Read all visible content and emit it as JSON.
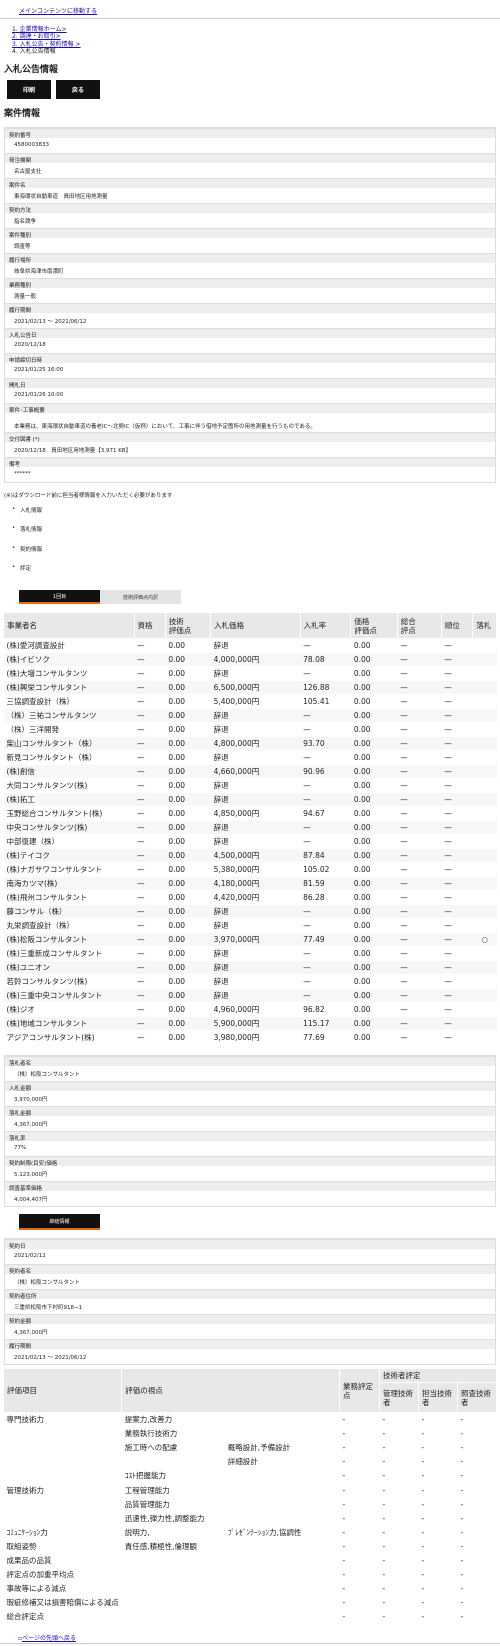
{
  "skip_link": "メインコンテンツに移動する",
  "breadcrumb": [
    "1. 企業情報ホーム>",
    "2. 調達・お取引>",
    "3. 入札公告・契約情報 >",
    "4. 入札公告情報"
  ],
  "page_title": "入札公告情報",
  "buttons": {
    "print": "印刷",
    "back": "戻る"
  },
  "section_title": "案件情報",
  "info": [
    {
      "label": "契約番号",
      "value": "4580003833"
    },
    {
      "label": "発注機関",
      "value": "名古屋支社"
    },
    {
      "label": "案件名",
      "value": "東海環状自動車道　員田地区用地測量"
    },
    {
      "label": "契約方法",
      "value": "指名競争"
    },
    {
      "label": "案件種別",
      "value": "調査等"
    },
    {
      "label": "履行場所",
      "value": "岐阜県海津市南濃町"
    },
    {
      "label": "業務種別",
      "value": "測量一般"
    },
    {
      "label": "履行期間",
      "value": "2021/02/13 ～ 2021/06/12"
    },
    {
      "label": "入札公告日",
      "value": "2020/12/18"
    },
    {
      "label": "申請締切日時",
      "value": "2021/01/25 16:00"
    },
    {
      "label": "開札日",
      "value": "2021/01/26 10:00"
    },
    {
      "label": "案件･工事概要",
      "value": "本業務は、東海環状自動車道の養老IC～北勢IC（仮称）において、工事に伴う借地予定箇所の用地測量を行うものである。"
    },
    {
      "label": "交付図書 (*)",
      "value": "2020/12/18　員田地区用地測量【3,971 KB】"
    },
    {
      "label": "備考",
      "value": "******"
    }
  ],
  "download_note": "(※)はダウンロード前に担当者様情報を入力いただく必要があります",
  "links": [
    "入札情報",
    "落札情報",
    "契約情報",
    "評定"
  ],
  "tabs": {
    "round1": "1回目",
    "tech": "技術評価点内訳"
  },
  "bid_headers": [
    "事業者名",
    "資格",
    "技術\n評価点",
    "入札価格",
    "入札率",
    "価格\n評価点",
    "総合\n評点",
    "順位",
    "落札"
  ],
  "bids": [
    [
      "(株)愛河調査設計",
      "—",
      "0.00",
      "辞退",
      "—",
      "0.00",
      "—",
      "—",
      ""
    ],
    [
      "(株)イビソク",
      "—",
      "0.00",
      "4,000,000円",
      "78.08",
      "0.00",
      "—",
      "—",
      ""
    ],
    [
      "(株)大増コンサルタンツ",
      "—",
      "0.00",
      "辞退",
      "—",
      "0.00",
      "—",
      "—",
      ""
    ],
    [
      "(株)興栄コンサルタント",
      "—",
      "0.00",
      "6,500,000円",
      "126.88",
      "0.00",
      "—",
      "—",
      ""
    ],
    [
      "三協調査設計（株）",
      "—",
      "0.00",
      "5,400,000円",
      "105.41",
      "0.00",
      "—",
      "—",
      ""
    ],
    [
      "（株）三祐コンサルタンツ",
      "—",
      "0.00",
      "辞退",
      "—",
      "0.00",
      "—",
      "—",
      ""
    ],
    [
      "（株）三洋開発",
      "—",
      "0.00",
      "辞退",
      "—",
      "0.00",
      "—",
      "—",
      ""
    ],
    [
      "柴山コンサルタント（株）",
      "—",
      "0.00",
      "4,800,000円",
      "93.70",
      "0.00",
      "—",
      "—",
      ""
    ],
    [
      "新見コンサルタント（株）",
      "—",
      "0.00",
      "辞退",
      "—",
      "0.00",
      "—",
      "—",
      ""
    ],
    [
      "(株)創信",
      "—",
      "0.00",
      "4,660,000円",
      "90.96",
      "0.00",
      "—",
      "—",
      ""
    ],
    [
      "大同コンサルタンツ(株)",
      "—",
      "0.00",
      "辞退",
      "—",
      "0.00",
      "—",
      "—",
      ""
    ],
    [
      "(株)拓工",
      "—",
      "0.00",
      "辞退",
      "—",
      "0.00",
      "—",
      "—",
      ""
    ],
    [
      "玉野総合コンサルタント(株)",
      "—",
      "0.00",
      "4,850,000円",
      "94.67",
      "0.00",
      "—",
      "—",
      ""
    ],
    [
      "中央コンサルタンツ(株)",
      "—",
      "0.00",
      "辞退",
      "—",
      "0.00",
      "—",
      "—",
      ""
    ],
    [
      "中部復建（株）",
      "—",
      "0.00",
      "辞退",
      "—",
      "0.00",
      "—",
      "—",
      ""
    ],
    [
      "(株)テイコク",
      "—",
      "0.00",
      "4,500,000円",
      "87.84",
      "0.00",
      "—",
      "—",
      ""
    ],
    [
      "(株)ナガサワコンサルタント",
      "—",
      "0.00",
      "5,380,000円",
      "105.02",
      "0.00",
      "—",
      "—",
      ""
    ],
    [
      "南海カツマ(株)",
      "—",
      "0.00",
      "4,180,000円",
      "81.59",
      "0.00",
      "—",
      "—",
      ""
    ],
    [
      "(株)飛州コンサルタント",
      "—",
      "0.00",
      "4,420,000円",
      "86.28",
      "0.00",
      "—",
      "—",
      ""
    ],
    [
      "藤コンサル（株）",
      "—",
      "0.00",
      "辞退",
      "—",
      "0.00",
      "—",
      "—",
      ""
    ],
    [
      "丸栄調査設計（株）",
      "—",
      "0.00",
      "辞退",
      "—",
      "0.00",
      "—",
      "—",
      ""
    ],
    [
      "(株)松阪コンサルタント",
      "—",
      "0.00",
      "3,970,000円",
      "77.49",
      "0.00",
      "—",
      "—",
      "○"
    ],
    [
      "(株)三重新成コンサルタント",
      "—",
      "0.00",
      "辞退",
      "—",
      "0.00",
      "—",
      "—",
      ""
    ],
    [
      "(株)ユニオン",
      "—",
      "0.00",
      "辞退",
      "—",
      "0.00",
      "—",
      "—",
      ""
    ],
    [
      "若鈴コンサルタンツ(株)",
      "—",
      "0.00",
      "辞退",
      "—",
      "0.00",
      "—",
      "—",
      ""
    ],
    [
      "(株)三重中央コンサルタント",
      "—",
      "0.00",
      "辞退",
      "—",
      "0.00",
      "—",
      "—",
      ""
    ],
    [
      "(株)ジオ",
      "—",
      "0.00",
      "4,960,000円",
      "96.82",
      "0.00",
      "—",
      "—",
      ""
    ],
    [
      "(株)地域コンサルタント",
      "—",
      "0.00",
      "5,900,000円",
      "115.17",
      "0.00",
      "—",
      "—",
      ""
    ],
    [
      "アジアコンサルタント(株)",
      "—",
      "0.00",
      "3,980,000円",
      "77.69",
      "0.00",
      "—",
      "—",
      ""
    ]
  ],
  "award": [
    {
      "label": "落札者名",
      "value": "（株）松阪コンサルタント"
    },
    {
      "label": "入札金額",
      "value": "3,970,000円"
    },
    {
      "label": "落札金額",
      "value": "4,367,000円"
    },
    {
      "label": "落札率",
      "value": "77%"
    },
    {
      "label": "契約制限(目安)価格",
      "value": "5,123,000円"
    },
    {
      "label": "調査基準価格",
      "value": "4,004,407円"
    }
  ],
  "contract_tab": "締結情報",
  "contract": [
    {
      "label": "契約日",
      "value": "2021/02/12"
    },
    {
      "label": "契約者名",
      "value": "（株）松阪コンサルタント"
    },
    {
      "label": "契約者住所",
      "value": "三重県松阪市下村町918−1"
    },
    {
      "label": "契約金額",
      "value": "4,367,000円"
    },
    {
      "label": "履行期間",
      "value": "2021/02/13 ～ 2021/06/12"
    }
  ],
  "eval_headers": {
    "item": "評価項目",
    "view": "評価の視点",
    "score": "業務評定点",
    "tech": "技術者評定",
    "mgr": "管理技術者",
    "resp": "担当技術者",
    "check": "照査技術者"
  },
  "eval_rows": [
    [
      "専門技術力",
      "提案力,改善力",
      "",
      "-",
      "-",
      "-",
      "-"
    ],
    [
      "",
      "業務執行技術力",
      "",
      "-",
      "-",
      "-",
      "-"
    ],
    [
      "",
      "施工時への配慮",
      "概略設計,予備設計",
      "-",
      "-",
      "-",
      "-"
    ],
    [
      "",
      "",
      "詳細設計",
      "-",
      "-",
      "-",
      "-"
    ],
    [
      "",
      "ｺｽﾄ把握能力",
      "",
      "-",
      "-",
      "-",
      "-"
    ],
    [
      "管理技術力",
      "工程管理能力",
      "",
      "-",
      "-",
      "-",
      "-"
    ],
    [
      "",
      "品質管理能力",
      "",
      "-",
      "-",
      "-",
      "-"
    ],
    [
      "",
      "迅速性,弾力性,調整能力",
      "",
      "-",
      "-",
      "-",
      "-"
    ],
    [
      "ｺﾐｭﾆｹｰｼｮﾝ力",
      "説明力,",
      "ﾌﾟﾚｾﾞﾝﾃｰｼｮﾝ力,協調性",
      "-",
      "-",
      "-",
      "-"
    ],
    [
      "取組姿勢",
      "責任感,積極性,倫理観",
      "",
      "-",
      "-",
      "-",
      "-"
    ],
    [
      "成果品の品質",
      "",
      "",
      "-",
      "-",
      "-",
      "-"
    ],
    [
      "評定点の加重平均点",
      "",
      "",
      "-",
      "-",
      "-",
      "-"
    ],
    [
      "事故等による減点",
      "",
      "",
      "-",
      "-",
      "-",
      "-"
    ],
    [
      "瑕疵修補又は損害賠償による減点",
      "",
      "",
      "-",
      "-",
      "-",
      "-"
    ],
    [
      "総合評定点",
      "",
      "",
      "-",
      "-",
      "-",
      "-"
    ]
  ],
  "to_top": "ページの先頭へ戻る"
}
